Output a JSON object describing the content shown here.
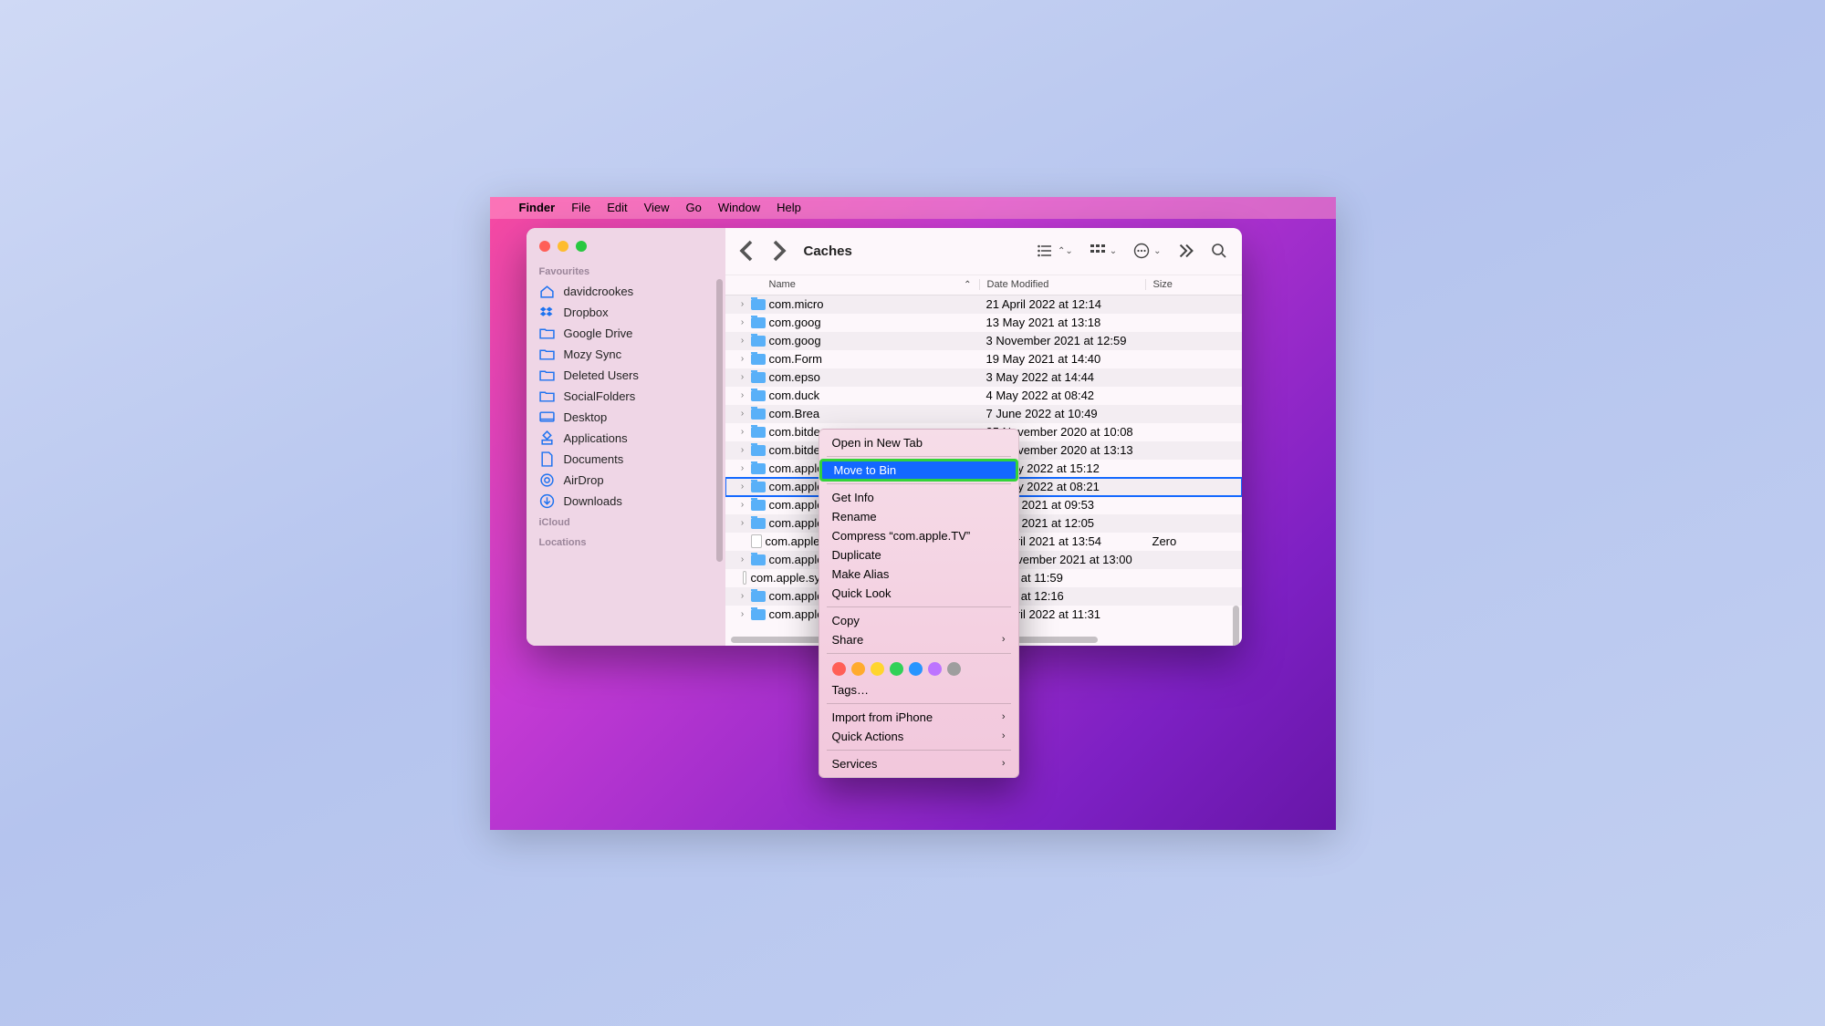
{
  "menubar": {
    "app": "Finder",
    "items": [
      "File",
      "Edit",
      "View",
      "Go",
      "Window",
      "Help"
    ]
  },
  "sidebar": {
    "sections": [
      {
        "title": "Favourites",
        "items": [
          {
            "icon": "home",
            "label": "davidcrookes"
          },
          {
            "icon": "dropbox",
            "label": "Dropbox"
          },
          {
            "icon": "folder",
            "label": "Google Drive"
          },
          {
            "icon": "folder",
            "label": "Mozy Sync"
          },
          {
            "icon": "folder",
            "label": "Deleted Users"
          },
          {
            "icon": "folder",
            "label": "SocialFolders"
          },
          {
            "icon": "desktop",
            "label": "Desktop"
          },
          {
            "icon": "apps",
            "label": "Applications"
          },
          {
            "icon": "doc",
            "label": "Documents"
          },
          {
            "icon": "airdrop",
            "label": "AirDrop"
          },
          {
            "icon": "download",
            "label": "Downloads"
          }
        ]
      },
      {
        "title": "iCloud",
        "items": []
      },
      {
        "title": "Locations",
        "items": []
      }
    ]
  },
  "toolbar": {
    "title": "Caches"
  },
  "columns": {
    "name": "Name",
    "date": "Date Modified",
    "size": "Size"
  },
  "files": [
    {
      "type": "folder",
      "name": "com.apple.Spotlight",
      "date": "26 April 2022 at 11:31",
      "size": ""
    },
    {
      "type": "folder",
      "name": "com.apple.systempreferences",
      "date": "Today at 12:16",
      "size": ""
    },
    {
      "type": "doc",
      "name": "com.apple.systempreferences.imageCache",
      "date": "Today at 11:59",
      "size": ""
    },
    {
      "type": "folder",
      "name": "com.apple.tipsd",
      "date": "11 November 2021 at 13:00",
      "size": ""
    },
    {
      "type": "doc",
      "name": "com.apple.tiswitcher.cache",
      "date": "30 April 2021 at 13:54",
      "size": "Zero"
    },
    {
      "type": "folder",
      "name": "com.apple.translationd",
      "date": "4 May 2021 at 12:05",
      "size": ""
    },
    {
      "type": "folder",
      "name": "com.apple.transparencyd",
      "date": "1 May 2021 at 09:53",
      "size": ""
    },
    {
      "type": "folder",
      "name": "com.apple",
      "date": "15 July 2022 at 08:21",
      "size": "",
      "selected": true
    },
    {
      "type": "folder",
      "name": "com.apple",
      "date": "15 July 2022 at 15:12",
      "size": ""
    },
    {
      "type": "folder",
      "name": "com.bitde",
      "date": "29 November 2020 at 13:13",
      "size": ""
    },
    {
      "type": "folder",
      "name": "com.bitde",
      "date": "25 November 2020 at 10:08",
      "size": ""
    },
    {
      "type": "folder",
      "name": "com.Brea",
      "date": "7 June 2022 at 10:49",
      "size": ""
    },
    {
      "type": "folder",
      "name": "com.duck",
      "date": "4 May 2022 at 08:42",
      "size": ""
    },
    {
      "type": "folder",
      "name": "com.epso",
      "date": "3 May 2022 at 14:44",
      "size": ""
    },
    {
      "type": "folder",
      "name": "com.Form",
      "date": "19 May 2021 at 14:40",
      "size": ""
    },
    {
      "type": "folder",
      "name": "com.goog",
      "date": "3 November 2021 at 12:59",
      "size": ""
    },
    {
      "type": "folder",
      "name": "com.goog",
      "date": "13 May 2021 at 13:18",
      "size": ""
    },
    {
      "type": "folder",
      "name": "com.micro",
      "date": "21 April 2022 at 12:14",
      "size": ""
    }
  ],
  "ctx": {
    "open_new_tab": "Open in New Tab",
    "move_to_bin": "Move to Bin",
    "get_info": "Get Info",
    "rename": "Rename",
    "compress": "Compress “com.apple.TV”",
    "duplicate": "Duplicate",
    "make_alias": "Make Alias",
    "quick_look": "Quick Look",
    "copy": "Copy",
    "share": "Share",
    "tags": "Tags…",
    "import": "Import from iPhone",
    "quick_actions": "Quick Actions",
    "services": "Services",
    "tag_colors": [
      "#ff5f57",
      "#ffab2e",
      "#ffd52e",
      "#31d158",
      "#2895ff",
      "#bd74ff",
      "#9e9e9e"
    ]
  }
}
